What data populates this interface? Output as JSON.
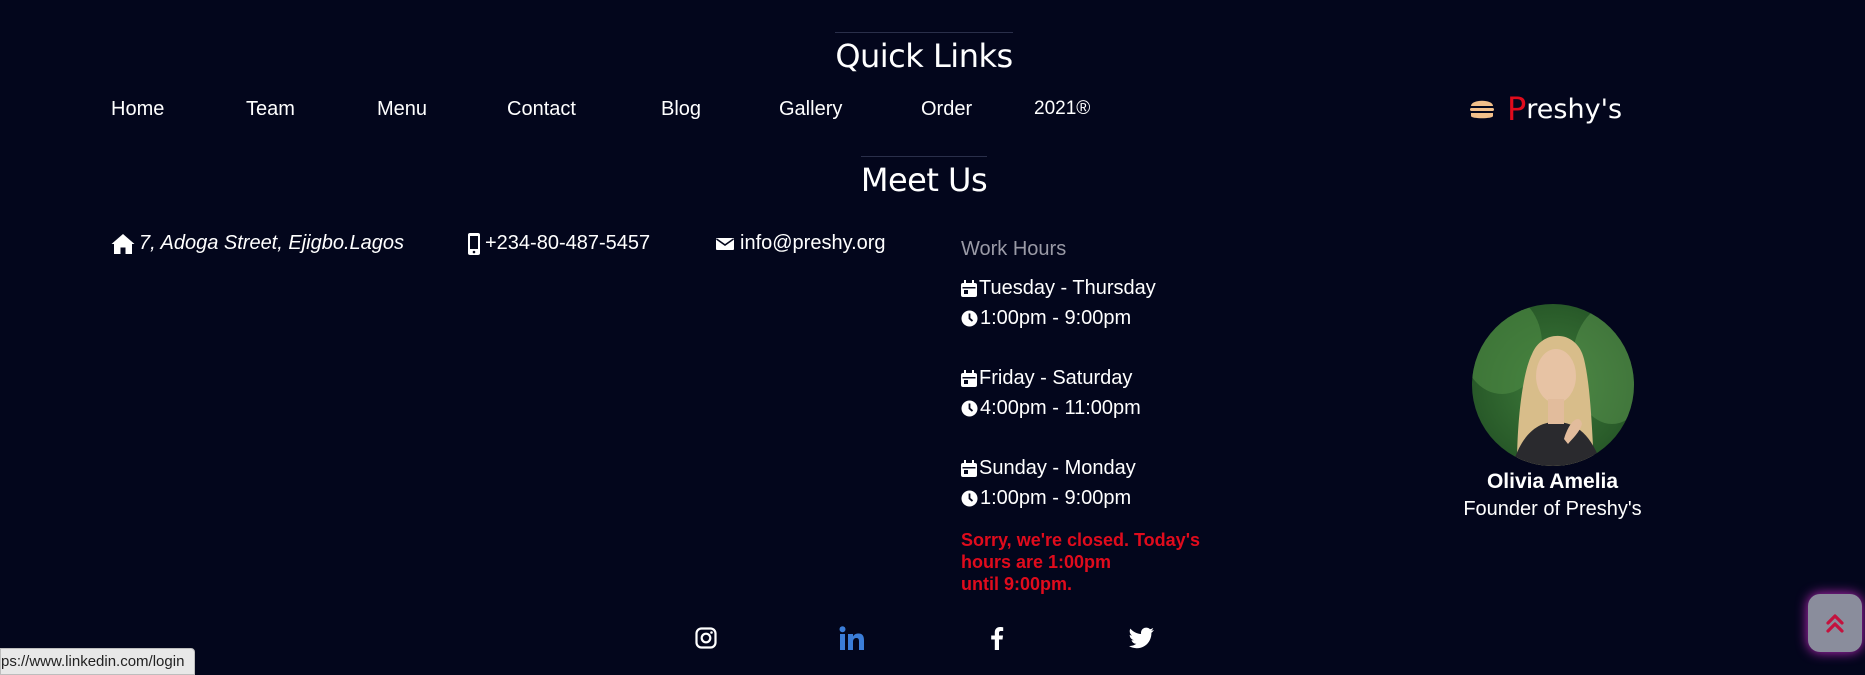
{
  "sections": {
    "quick_links": "Quick Links",
    "meet_us": "Meet Us"
  },
  "nav": {
    "home": "Home",
    "team": "Team",
    "menu": "Menu",
    "contact": "Contact",
    "blog": "Blog",
    "gallery": "Gallery",
    "order": "Order",
    "year": "2021®"
  },
  "brand": {
    "initial": "P",
    "rest": "reshy's",
    "icon": "burger-icon"
  },
  "contact": {
    "address": "7, Adoga Street, Ejigbo.Lagos",
    "phone": "+234-80-487-5457",
    "email": "info@preshy.org"
  },
  "hours": {
    "label": "Work Hours",
    "slots": [
      {
        "days": "Tuesday - Thursday",
        "time": "1:00pm - 9:00pm"
      },
      {
        "days": " Friday - Saturday",
        "time": " 4:00pm - 11:00pm"
      },
      {
        "days": " Sunday - Monday",
        "time": "1:00pm - 9:00pm"
      }
    ],
    "closed_line1": "Sorry, we're closed. Today's",
    "closed_line2": "hours are 1:00pm",
    "closed_line3": "until 9:00pm."
  },
  "founder": {
    "name": "Olivia Amelia",
    "role": "Founder of Preshy's"
  },
  "social": [
    "instagram-icon",
    "linkedin-icon",
    "facebook-icon",
    "twitter-icon"
  ],
  "status_url": "ps://www.linkedin.com/login",
  "colors": {
    "background": "#03061c",
    "accent_red": "#e00b1c",
    "linkedin_hover": "#3b7dd8"
  }
}
